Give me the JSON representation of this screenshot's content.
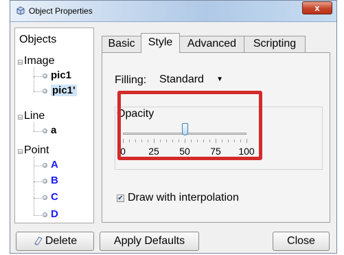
{
  "window": {
    "title": "Object Properties",
    "close_glyph": "x"
  },
  "tree": {
    "root": "Objects",
    "categories": [
      {
        "label": "Image",
        "children": [
          {
            "label": "pic1",
            "color": "#000000"
          },
          {
            "label": "pic1'",
            "color": "#000000"
          }
        ]
      },
      {
        "label": "Line",
        "children": [
          {
            "label": "a",
            "color": "#000000"
          }
        ]
      },
      {
        "label": "Point",
        "children": [
          {
            "label": "A",
            "color": "#1a1aff"
          },
          {
            "label": "B",
            "color": "#1a1aff"
          },
          {
            "label": "C",
            "color": "#1a1aff"
          },
          {
            "label": "D",
            "color": "#1a1aff"
          }
        ]
      }
    ],
    "selected": "pic1'"
  },
  "tabs": [
    "Basic",
    "Style",
    "Advanced",
    "Scripting"
  ],
  "active_tab": "Style",
  "style": {
    "filling_label": "Filling:",
    "filling_value": "Standard",
    "opacity_label": "Opacity",
    "opacity_value": 50,
    "ticks": [
      "0",
      "25",
      "50",
      "75",
      "100"
    ],
    "checkbox_label": "Draw with interpolation",
    "checkbox_checked": true,
    "check_glyph": "✔"
  },
  "buttons": {
    "delete": "Delete",
    "apply_defaults": "Apply Defaults",
    "close": "Close"
  },
  "colors": {
    "highlight": "#d42a2a",
    "point_label": "#1a1aff",
    "slider_thumb": "#3c7fb1"
  },
  "icons": {
    "title": "object-properties-icon",
    "delete": "eraser-icon",
    "dropdown": "chevron-down-icon"
  }
}
